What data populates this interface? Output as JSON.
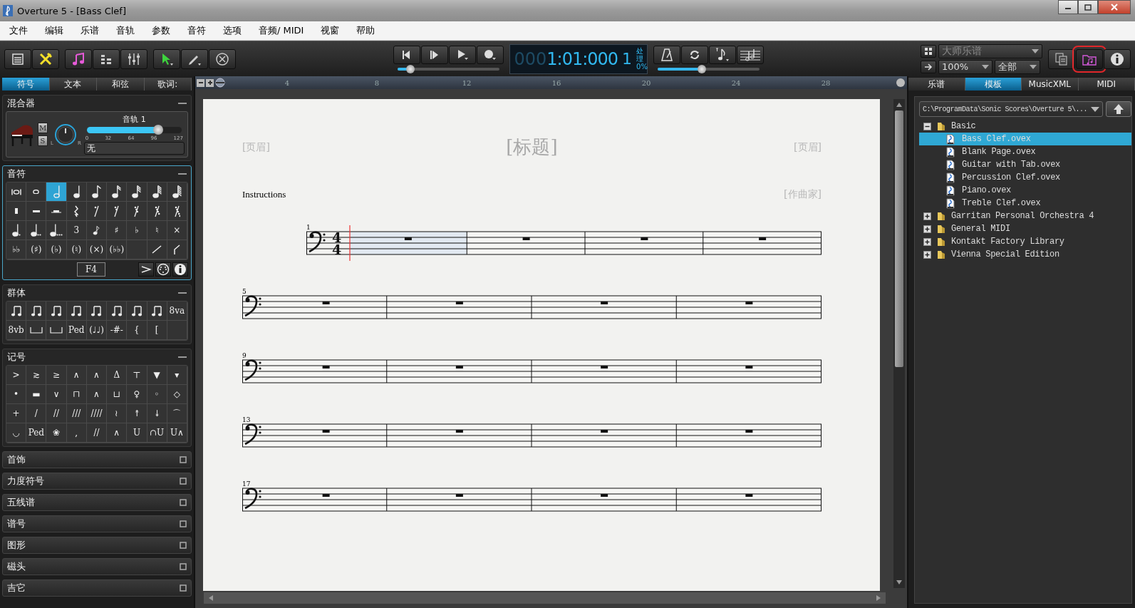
{
  "window": {
    "title": "Overture 5 - [Bass Clef]"
  },
  "menu": [
    "文件",
    "编辑",
    "乐谱",
    "音轨",
    "参数",
    "音符",
    "选项",
    "音频/ MIDI",
    "视窗",
    "帮助"
  ],
  "transport": {
    "counter_dim": "000",
    "counter": "1:01:000",
    "beat": "1",
    "cpu_label": "处理",
    "cpu_value": "0%",
    "level": 0.13
  },
  "tools_slider": {
    "level": 0.44
  },
  "view_controls": {
    "score_style": "大师乐谱",
    "zoom": "100%",
    "parts": "全部"
  },
  "library_button": {
    "highlighted": true
  },
  "left_tabs": [
    {
      "label": "符号",
      "selected": true
    },
    {
      "label": "文本",
      "selected": false
    },
    {
      "label": "和弦",
      "selected": false
    },
    {
      "label": "歌词:",
      "selected": false
    }
  ],
  "mixer": {
    "title": "混合器",
    "track": "音轨 1",
    "mute": "M",
    "solo": "S",
    "pan_left": "L",
    "pan_right": "R",
    "level": 0.75,
    "scale": [
      "0",
      "32",
      "64",
      "96",
      "127"
    ],
    "instrument": "无"
  },
  "note_palette": {
    "title": "音符",
    "pitch": "F4",
    "items": [
      {
        "kind": "breve",
        "selected": false
      },
      {
        "kind": "whole",
        "selected": false
      },
      {
        "kind": "half",
        "selected": true
      },
      {
        "kind": "quarter",
        "selected": false
      },
      {
        "kind": "eighth",
        "selected": false
      },
      {
        "kind": "sixteenth",
        "selected": false
      },
      {
        "kind": "thirtysecond",
        "selected": false
      },
      {
        "kind": "sixtyfourth",
        "selected": false
      },
      {
        "kind": "hundredtwentyeighth",
        "selected": false
      },
      {
        "kind": "breverest",
        "selected": false
      },
      {
        "kind": "wholerest",
        "selected": false
      },
      {
        "kind": "halfrest",
        "selected": false
      },
      {
        "kind": "quarterrest",
        "selected": false
      },
      {
        "kind": "eighthrest",
        "selected": false
      },
      {
        "kind": "sixteenthrest",
        "selected": false
      },
      {
        "kind": "thirtysecondrest",
        "selected": false
      },
      {
        "kind": "sixtyfourthrest",
        "selected": false
      },
      {
        "kind": "hundredtwentyeighthrest",
        "selected": false
      },
      {
        "kind": "dotted",
        "selected": false
      },
      {
        "kind": "doubledotted",
        "selected": false
      },
      {
        "kind": "tripledotted",
        "selected": false
      },
      {
        "kind": "glyph",
        "text": "3",
        "selected": false
      },
      {
        "kind": "grace",
        "selected": false
      },
      {
        "kind": "glyph",
        "text": "♯",
        "selected": false
      },
      {
        "kind": "glyph",
        "text": "♭",
        "selected": false
      },
      {
        "kind": "glyph",
        "text": "♮",
        "selected": false
      },
      {
        "kind": "glyph",
        "text": "×",
        "selected": false
      },
      {
        "kind": "glyph",
        "text": "♭♭",
        "selected": false
      },
      {
        "kind": "glyph",
        "text": "(♯)",
        "selected": false
      },
      {
        "kind": "glyph",
        "text": "(♭)",
        "selected": false
      },
      {
        "kind": "glyph",
        "text": "(♮)",
        "selected": false
      },
      {
        "kind": "glyph",
        "text": "(×)",
        "selected": false
      },
      {
        "kind": "glyph",
        "text": "(♭♭)",
        "selected": false
      },
      {
        "kind": "empty",
        "selected": false
      },
      {
        "kind": "line",
        "selected": false
      },
      {
        "kind": "hook",
        "selected": false
      }
    ]
  },
  "tuplet_palette": {
    "title": "群体",
    "items": [
      {
        "kind": "beam"
      },
      {
        "kind": "beam"
      },
      {
        "kind": "beam"
      },
      {
        "kind": "beam"
      },
      {
        "kind": "beam"
      },
      {
        "kind": "beam"
      },
      {
        "kind": "beam"
      },
      {
        "kind": "beam"
      },
      {
        "kind": "glyph",
        "text": "8va"
      },
      {
        "kind": "glyph",
        "text": "8vb"
      },
      {
        "kind": "bracket"
      },
      {
        "kind": "bracket"
      },
      {
        "kind": "glyph",
        "text": "Ped"
      },
      {
        "kind": "glyph",
        "text": "(♩♩)"
      },
      {
        "kind": "glyph",
        "text": "-#-"
      },
      {
        "kind": "glyph",
        "text": "{"
      },
      {
        "kind": "glyph",
        "text": "["
      },
      {
        "kind": "empty"
      }
    ]
  },
  "marks_palette": {
    "title": "记号",
    "items": [
      ">",
      "≳",
      "≥",
      "∧",
      "∧",
      "Δ",
      "⊤",
      "▼",
      "▾",
      "•",
      "▬",
      "∨",
      "⊓",
      "∧",
      "⊔",
      "♀",
      "◦",
      "◇",
      "+",
      "/",
      "//",
      "///",
      "////",
      "≀",
      "↟",
      "↡",
      "⌒",
      "◡",
      "Ped",
      "❀",
      ",",
      "//",
      "∧",
      "U",
      "∩U",
      "U∧"
    ]
  },
  "collapsed_sections": [
    "首饰",
    "力度符号",
    "五线谱",
    "谱号",
    "图形",
    "磁头",
    "吉它"
  ],
  "ruler": {
    "marks": [
      "4",
      "8",
      "12",
      "16",
      "20",
      "24",
      "28"
    ]
  },
  "score": {
    "header_left": "[页眉]",
    "title": "[标题]",
    "header_right": "[页眉]",
    "instructions": "Instructions",
    "composer": "[作曲家]",
    "systems": [
      {
        "number": "1",
        "time_signature": [
          "4",
          "4"
        ],
        "measures": [
          {
            "selected": true
          },
          {
            "selected": false
          },
          {
            "selected": false
          },
          {
            "selected": false
          }
        ]
      },
      {
        "number": "5",
        "measures": [
          {
            "selected": false
          },
          {
            "selected": false
          },
          {
            "selected": false
          },
          {
            "selected": false
          }
        ]
      },
      {
        "number": "9",
        "measures": [
          {
            "selected": false
          },
          {
            "selected": false
          },
          {
            "selected": false
          },
          {
            "selected": false
          }
        ]
      },
      {
        "number": "13",
        "measures": [
          {
            "selected": false
          },
          {
            "selected": false
          },
          {
            "selected": false
          },
          {
            "selected": false
          }
        ]
      },
      {
        "number": "17",
        "measures": [
          {
            "selected": false
          },
          {
            "selected": false
          },
          {
            "selected": false
          },
          {
            "selected": false
          }
        ]
      }
    ]
  },
  "right_tabs": [
    {
      "label": "乐谱",
      "selected": false
    },
    {
      "label": "模板",
      "selected": true
    },
    {
      "label": "MusicXML",
      "selected": false
    },
    {
      "label": "MIDI",
      "selected": false
    }
  ],
  "template_path": "C:\\ProgramData\\Sonic Scores\\Overture 5\\...",
  "tree": [
    {
      "label": "Basic",
      "expanded": true,
      "children": [
        {
          "label": "Bass Clef.ovex",
          "selected": true
        },
        {
          "label": "Blank Page.ovex",
          "selected": false
        },
        {
          "label": "Guitar with Tab.ovex",
          "selected": false
        },
        {
          "label": "Percussion Clef.ovex",
          "selected": false
        },
        {
          "label": "Piano.ovex",
          "selected": false
        },
        {
          "label": "Treble Clef.ovex",
          "selected": false
        }
      ]
    },
    {
      "label": "Garritan Personal Orchestra 4",
      "expanded": false
    },
    {
      "label": "General MIDI",
      "expanded": false
    },
    {
      "label": "Kontakt Factory Library",
      "expanded": false
    },
    {
      "label": "Vienna Special Edition",
      "expanded": false
    }
  ]
}
